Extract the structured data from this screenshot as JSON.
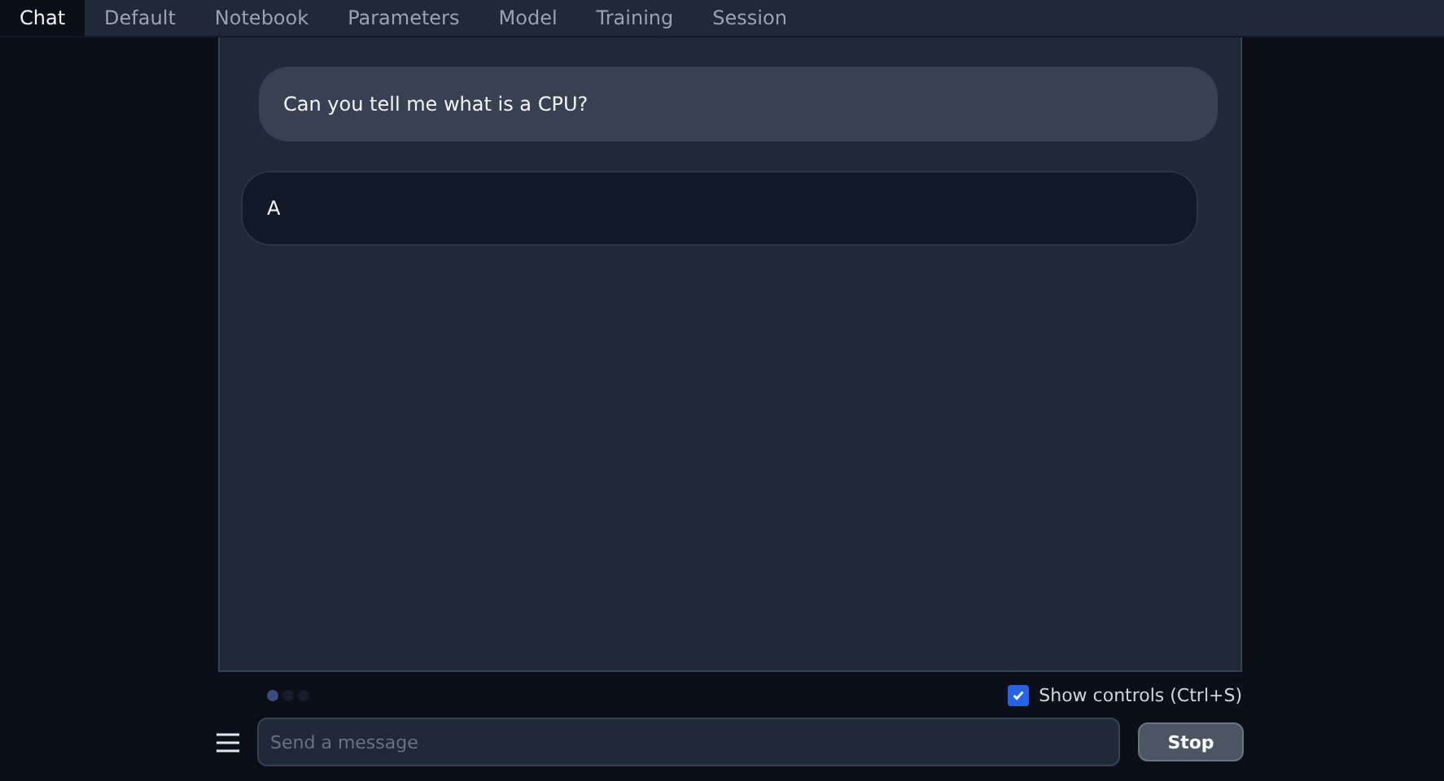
{
  "tabs": [
    {
      "label": "Chat",
      "selected": true
    },
    {
      "label": "Default",
      "selected": false
    },
    {
      "label": "Notebook",
      "selected": false
    },
    {
      "label": "Parameters",
      "selected": false
    },
    {
      "label": "Model",
      "selected": false
    },
    {
      "label": "Training",
      "selected": false
    },
    {
      "label": "Session",
      "selected": false
    }
  ],
  "messages": [
    {
      "kind": "user",
      "text": "Can you tell me what is a CPU?"
    },
    {
      "kind": "bot",
      "text": "A"
    }
  ],
  "show_controls": {
    "label": "Show controls (Ctrl+S)",
    "checked": true
  },
  "input": {
    "placeholder": "Send a message"
  },
  "stop_button": "Stop"
}
